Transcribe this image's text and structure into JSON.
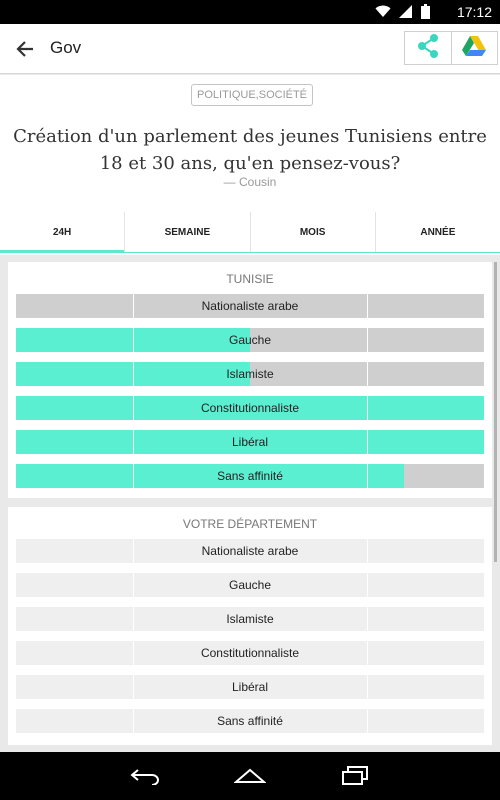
{
  "status_bar": {
    "time": "17:12",
    "wifi_icon": "wifi-icon",
    "signal_icon": "signal-icon",
    "battery_icon": "battery-icon"
  },
  "app_bar": {
    "back_icon": "arrow-back-icon",
    "title": "Gov",
    "share_icon": "share-icon",
    "drive_icon": "google-drive-icon"
  },
  "header": {
    "tag": "POLITIQUE,SOCIÉTÉ",
    "question": "Création d'un parlement des jeunes Tunisiens entre 18 et 30 ans, qu'en pensez-vous?",
    "author": "— Cousin"
  },
  "tabs": [
    {
      "label": "24H",
      "active": true
    },
    {
      "label": "SEMAINE",
      "active": false
    },
    {
      "label": "MOIS",
      "active": false
    },
    {
      "label": "ANNÉE",
      "active": false
    }
  ],
  "colors": {
    "accent": "#5aefd1",
    "track_national": "#cfcfcf",
    "track_department": "#efefef"
  },
  "national": {
    "title": "TUNISIE",
    "rows": [
      {
        "label": "Nationaliste arabe",
        "fill_fraction": 0.0
      },
      {
        "label": "Gauche",
        "fill_fraction": 0.5
      },
      {
        "label": "Islamiste",
        "fill_fraction": 0.5
      },
      {
        "label": "Constitutionnaliste",
        "fill_fraction": 1.0
      },
      {
        "label": "Libéral",
        "fill_fraction": 1.0
      },
      {
        "label": "Sans affinité",
        "fill_fraction": 0.83
      }
    ]
  },
  "department": {
    "title": "VOTRE DÉPARTEMENT",
    "rows": [
      {
        "label": "Nationaliste arabe",
        "fill_fraction": 0.0
      },
      {
        "label": "Gauche",
        "fill_fraction": 0.0
      },
      {
        "label": "Islamiste",
        "fill_fraction": 0.0
      },
      {
        "label": "Constitutionnaliste",
        "fill_fraction": 0.0
      },
      {
        "label": "Libéral",
        "fill_fraction": 0.0
      },
      {
        "label": "Sans affinité",
        "fill_fraction": 0.0
      }
    ]
  },
  "nav_bar": {
    "back_icon": "nav-back-icon",
    "home_icon": "nav-home-icon",
    "recents_icon": "nav-recents-icon"
  }
}
